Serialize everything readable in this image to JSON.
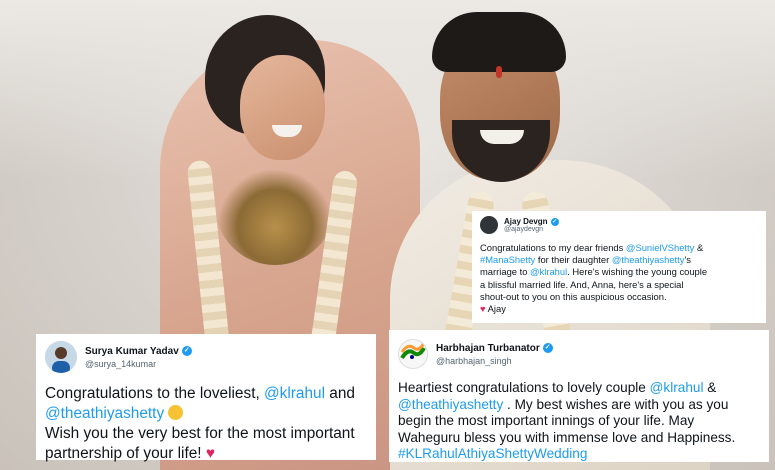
{
  "tweets": {
    "ajay": {
      "name": "Ajay Devgn",
      "handle": "@ajaydevgn",
      "verified_icon": "verified-check-icon",
      "line1_a": "Congratulations to my dear friends ",
      "line1_m1": "@SunielVShetty",
      "line1_b": " &",
      "line2_m": "#ManaShetty",
      "line2_a": " for their daughter ",
      "line2_m2": "@theathiyashetty",
      "line2_b": "'s",
      "line3_a": "marriage to ",
      "line3_m": "@klrahul",
      "line3_b": ". Here's wishing the young couple",
      "line4": "a blissful married life.  And, Anna, here's a special",
      "line5": "shout-out to you on this auspicious occasion.",
      "sign": "Ajay",
      "heart": "♥"
    },
    "surya": {
      "name": "Surya Kumar Yadav",
      "handle": "@surya_14kumar",
      "line1_a": "Congratulations to the loveliest, ",
      "line1_m": "@klrahul",
      "line1_b": " and",
      "line2_m": "@theathiyashetty",
      "line3": "Wish you the very best for the most important",
      "line4": "partnership of your life! ",
      "heart": "♥"
    },
    "bhaji": {
      "name": "Harbhajan Turbanator",
      "handle": "@harbhajan_singh",
      "line1_a": "Heartiest congratulations to lovely couple ",
      "line1_m": "@klrahul",
      "line1_b": " &",
      "line2_m": "@theathiyashetty",
      "line2_b": " . My best wishes are with you as you",
      "line3": "begin the most important innings of your life. May",
      "line4": "Waheguru bless you with immense love and Happiness.",
      "line5_m": "#KLRahulAthiyaShettyWedding"
    }
  },
  "colors": {
    "link": "#1d9bf0",
    "verified": "#1d9bf0",
    "heart": "#e0245e"
  }
}
